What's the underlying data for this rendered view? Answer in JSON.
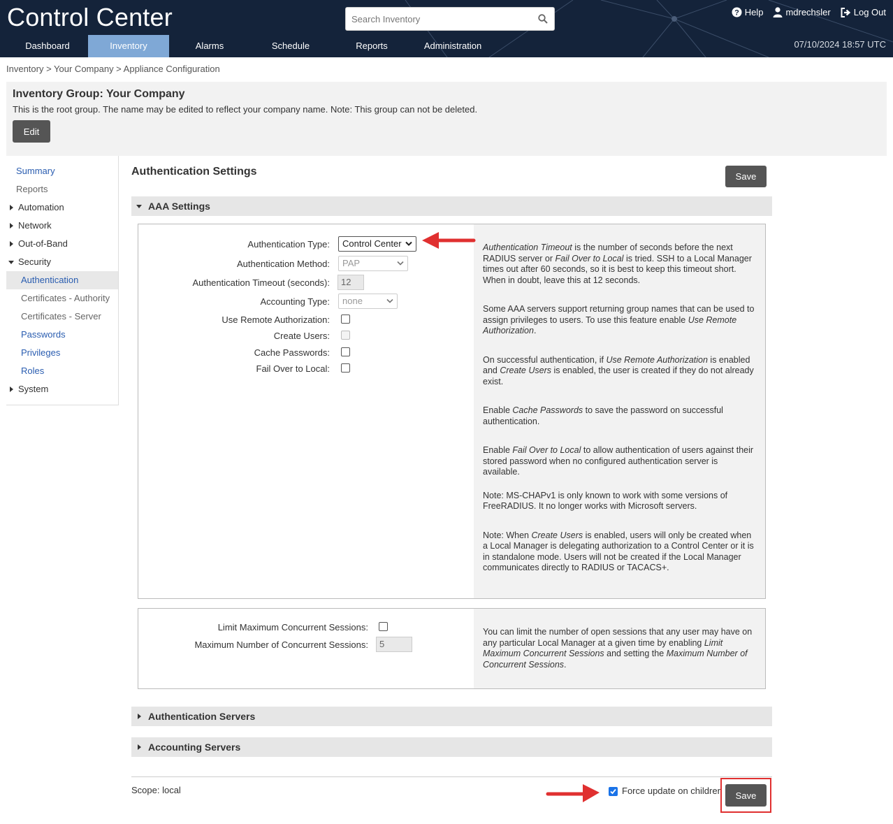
{
  "header": {
    "app_title": "Control Center",
    "search_placeholder": "Search Inventory",
    "help_label": "Help",
    "user_label": "mdrechsler",
    "logout_label": "Log Out",
    "datetime": "07/10/2024 18:57 UTC",
    "nav_tabs": [
      {
        "label": "Dashboard",
        "active": false
      },
      {
        "label": "Inventory",
        "active": true
      },
      {
        "label": "Alarms",
        "active": false
      },
      {
        "label": "Schedule",
        "active": false
      },
      {
        "label": "Reports",
        "active": false
      },
      {
        "label": "Administration",
        "active": false
      }
    ]
  },
  "breadcrumb": "Inventory > Your Company > Appliance Configuration",
  "group": {
    "title": "Inventory Group: Your Company",
    "description": "This is the root group. The name may be edited to reflect your company name. Note: This group can not be deleted.",
    "edit_label": "Edit"
  },
  "sidebar": {
    "summary": "Summary",
    "reports": "Reports",
    "automation": "Automation",
    "network": "Network",
    "out_of_band": "Out-of-Band",
    "security": "Security",
    "authentication": "Authentication",
    "cert_authority": "Certificates - Authority",
    "cert_server": "Certificates - Server",
    "passwords": "Passwords",
    "privileges": "Privileges",
    "roles": "Roles",
    "system": "System"
  },
  "main": {
    "title": "Authentication Settings",
    "save_label": "Save",
    "aaa_section": "AAA Settings",
    "auth_servers_section": "Authentication Servers",
    "acct_servers_section": "Accounting Servers"
  },
  "aaa_form": {
    "auth_type_label": "Authentication Type:",
    "auth_type_value": "Control Center",
    "auth_method_label": "Authentication Method:",
    "auth_method_value": "PAP",
    "auth_timeout_label": "Authentication Timeout (seconds):",
    "auth_timeout_value": "12",
    "accounting_type_label": "Accounting Type:",
    "accounting_type_value": "none",
    "use_remote_auth_label": "Use Remote Authorization:",
    "create_users_label": "Create Users:",
    "cache_passwords_label": "Cache Passwords:",
    "fail_over_label": "Fail Over to Local:"
  },
  "aaa_help": {
    "p1_em1": "Authentication Timeout",
    "p1_t1": " is the number of seconds before the next RADIUS server or ",
    "p1_em2": "Fail Over to Local",
    "p1_t2": " is tried. SSH to a Local Manager times out after 60 seconds, so it is best to keep this timeout short. When in doubt, leave this at 12 seconds.",
    "p2_t1": "Some AAA servers support returning group names that can be used to assign privileges to users. To use this feature enable ",
    "p2_em1": "Use Remote Authorization",
    "p2_t2": ".",
    "p3_t1": "On successful authentication, if ",
    "p3_em1": "Use Remote Authorization",
    "p3_t2": " is enabled and ",
    "p3_em2": "Create Users",
    "p3_t3": " is enabled, the user is created if they do not already exist.",
    "p4_t1": "Enable ",
    "p4_em1": "Cache Passwords",
    "p4_t2": " to save the password on successful authentication.",
    "p5_t1": "Enable ",
    "p5_em1": "Fail Over to Local",
    "p5_t2": " to allow authentication of users against their stored password when no configured authentication server is available.",
    "p6": "Note: MS-CHAPv1 is only known to work with some versions of FreeRADIUS. It no longer works with Microsoft servers.",
    "p7_t1": "Note: When ",
    "p7_em1": "Create Users",
    "p7_t2": " is enabled, users will only be created when a Local Manager is delegating authorization to a Control Center or it is in standalone mode. Users will not be created if the Local Manager communicates directly to RADIUS or TACACS+."
  },
  "sessions_form": {
    "limit_label": "Limit Maximum Concurrent Sessions:",
    "max_label": "Maximum Number of Concurrent Sessions:",
    "max_value": "5",
    "help_t1": "You can limit the number of open sessions that any user may have on any particular Local Manager at a given time by enabling ",
    "help_em1": "Limit Maximum Concurrent Sessions",
    "help_t2": " and setting the ",
    "help_em2": "Maximum Number of Concurrent Sessions",
    "help_t3": "."
  },
  "footer": {
    "scope": "Scope: local",
    "force_update_label": "Force update on children",
    "save_label": "Save"
  },
  "colors": {
    "header_bg": "#14233a",
    "active_tab": "#7fa8d6",
    "link": "#2a5db0",
    "annotation_red": "#e03030",
    "button_dark": "#555555"
  }
}
